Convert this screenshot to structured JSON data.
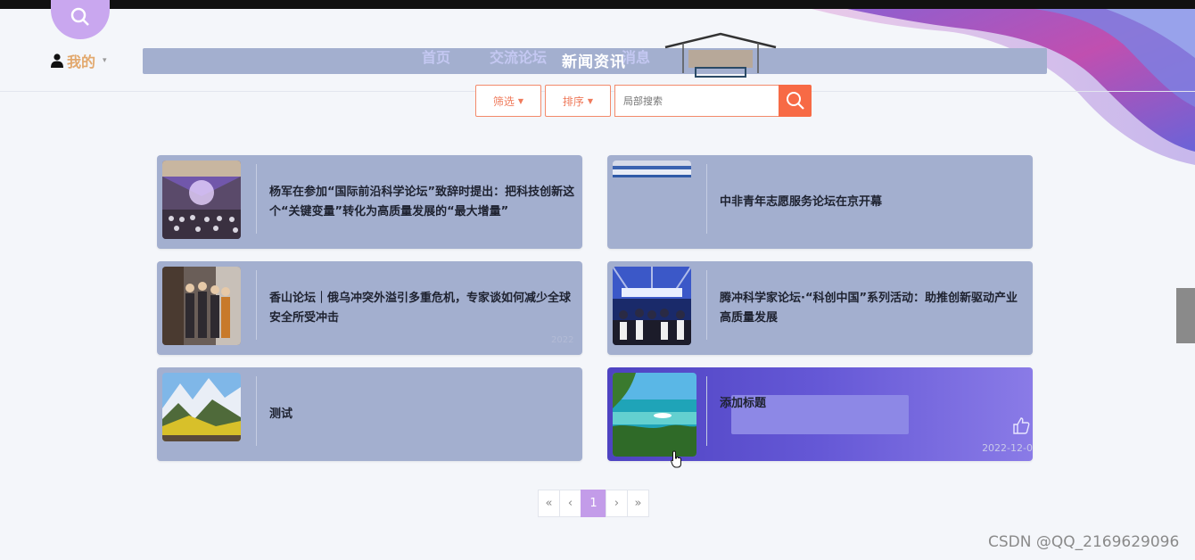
{
  "header": {
    "my_label": "我的",
    "nav_items": [
      "首页",
      "交流论坛",
      "消息",
      "新闻资讯"
    ],
    "nav_active": "新闻资讯"
  },
  "filters": {
    "filter_label": "筛选",
    "sort_label": "排序",
    "search_placeholder": "局部搜索"
  },
  "news": [
    {
      "title": "杨军在参加“国际前沿科学论坛”致辞时提出：把科技创新这个“关键变量”转化为高质量发展的“最大增量”",
      "thumb": "conference-hall"
    },
    {
      "title": "中非青年志愿服务论坛在京开幕",
      "thumb": "stage-banner"
    },
    {
      "title": "香山论坛｜俄乌冲突外溢引多重危机，专家谈如何减少全球安全所受冲击",
      "thumb": "people-group"
    },
    {
      "title": "腾冲科学家论坛·“科创中国”系列活动：助推创新驱动产业高质量发展",
      "thumb": "forum-stage"
    },
    {
      "title": "测试",
      "thumb": "mountain-landscape"
    },
    {
      "title": "添加标题",
      "thumb": "island-beach",
      "date": "2022-12-0"
    }
  ],
  "watermark_date": "2022",
  "pagination": {
    "first": "«",
    "prev": "‹",
    "current": "1",
    "next": "›",
    "last": "»"
  },
  "watermark_text": "CSDN @QQ_2169629096",
  "colors": {
    "accent": "#f76a45",
    "card": "#a3afcf",
    "active_page": "#c39ce9",
    "hover_card": "#5a4ecb"
  }
}
